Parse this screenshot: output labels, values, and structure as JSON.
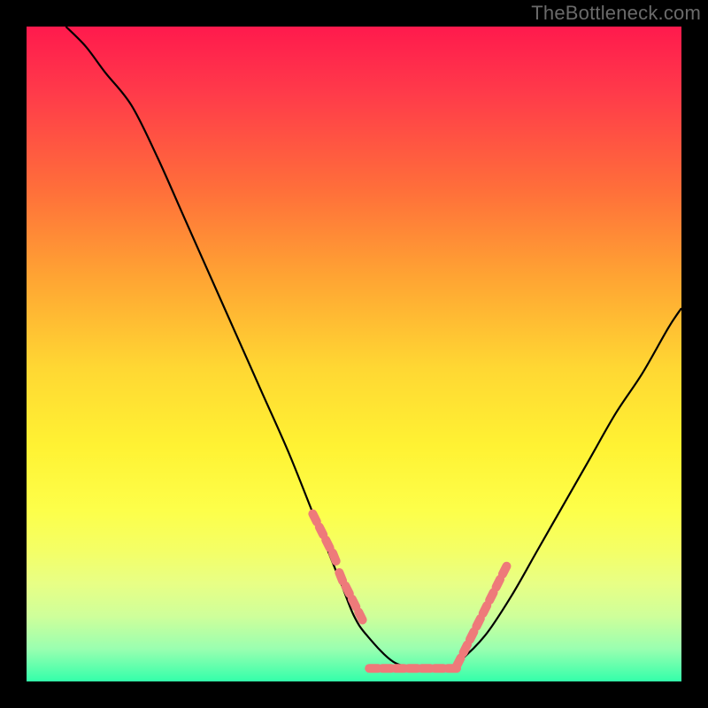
{
  "watermark": "TheBottleneck.com",
  "chart_data": {
    "type": "line",
    "title": "",
    "xlabel": "",
    "ylabel": "",
    "xlim": [
      0,
      100
    ],
    "ylim": [
      0,
      100
    ],
    "grid": false,
    "legend": false,
    "series": [
      {
        "name": "curve",
        "x": [
          6,
          9,
          12,
          16,
          20,
          24,
          28,
          32,
          36,
          40,
          44,
          48,
          50,
          52,
          56,
          60,
          62,
          64,
          66,
          70,
          74,
          78,
          82,
          86,
          90,
          94,
          98,
          100
        ],
        "values": [
          100,
          97,
          93,
          88,
          80,
          71,
          62,
          53,
          44,
          35,
          25,
          15,
          10,
          7,
          3,
          2,
          2,
          2,
          3,
          7,
          13,
          20,
          27,
          34,
          41,
          47,
          54,
          57
        ]
      }
    ],
    "green_band_markers": {
      "left": {
        "x": [
          44,
          45,
          46,
          47,
          48,
          49,
          50,
          51
        ],
        "y": [
          25,
          23,
          21,
          19,
          16,
          14,
          12,
          10
        ]
      },
      "right": {
        "x": [
          66,
          67,
          68,
          69,
          70,
          71,
          72,
          73
        ],
        "y": [
          3,
          5,
          7,
          9,
          11,
          13,
          15,
          17
        ]
      },
      "flat": {
        "x": [
          53,
          55,
          57,
          59,
          61,
          63,
          65
        ],
        "y": [
          2,
          2,
          2,
          2,
          2,
          2,
          2
        ]
      }
    },
    "colors": {
      "curve": "#000000",
      "marker": "#ee7a7a",
      "gradient_top": "#ff1a4d",
      "gradient_bottom": "#33ffaa"
    }
  }
}
